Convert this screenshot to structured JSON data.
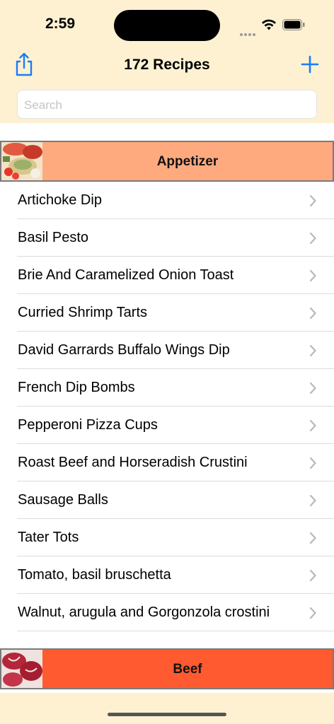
{
  "status": {
    "time": "2:59"
  },
  "nav": {
    "title": "172 Recipes"
  },
  "search": {
    "placeholder": "Search"
  },
  "sections": {
    "appetizer": {
      "label": "Appetizer",
      "color": "#ffaa7e"
    },
    "beef": {
      "label": "Beef",
      "color": "#ff5a30"
    }
  },
  "recipes": [
    "Artichoke Dip",
    "Basil Pesto",
    "Brie And Caramelized Onion Toast",
    "Curried Shrimp Tarts",
    "David Garrards Buffalo Wings Dip",
    "French Dip Bombs",
    "Pepperoni Pizza Cups",
    "Roast Beef and Horseradish Crustini",
    "Sausage Balls",
    "Tater Tots",
    "Tomato, basil bruschetta",
    "Walnut, arugula and Gorgonzola crostini"
  ],
  "icons": {
    "share": "share-icon",
    "add": "plus-icon",
    "chevron": "chevron-right-icon",
    "wifi": "wifi-icon",
    "battery": "battery-icon"
  },
  "colors": {
    "accent": "#1a7cf5",
    "header_bg": "#fdf1d2"
  }
}
